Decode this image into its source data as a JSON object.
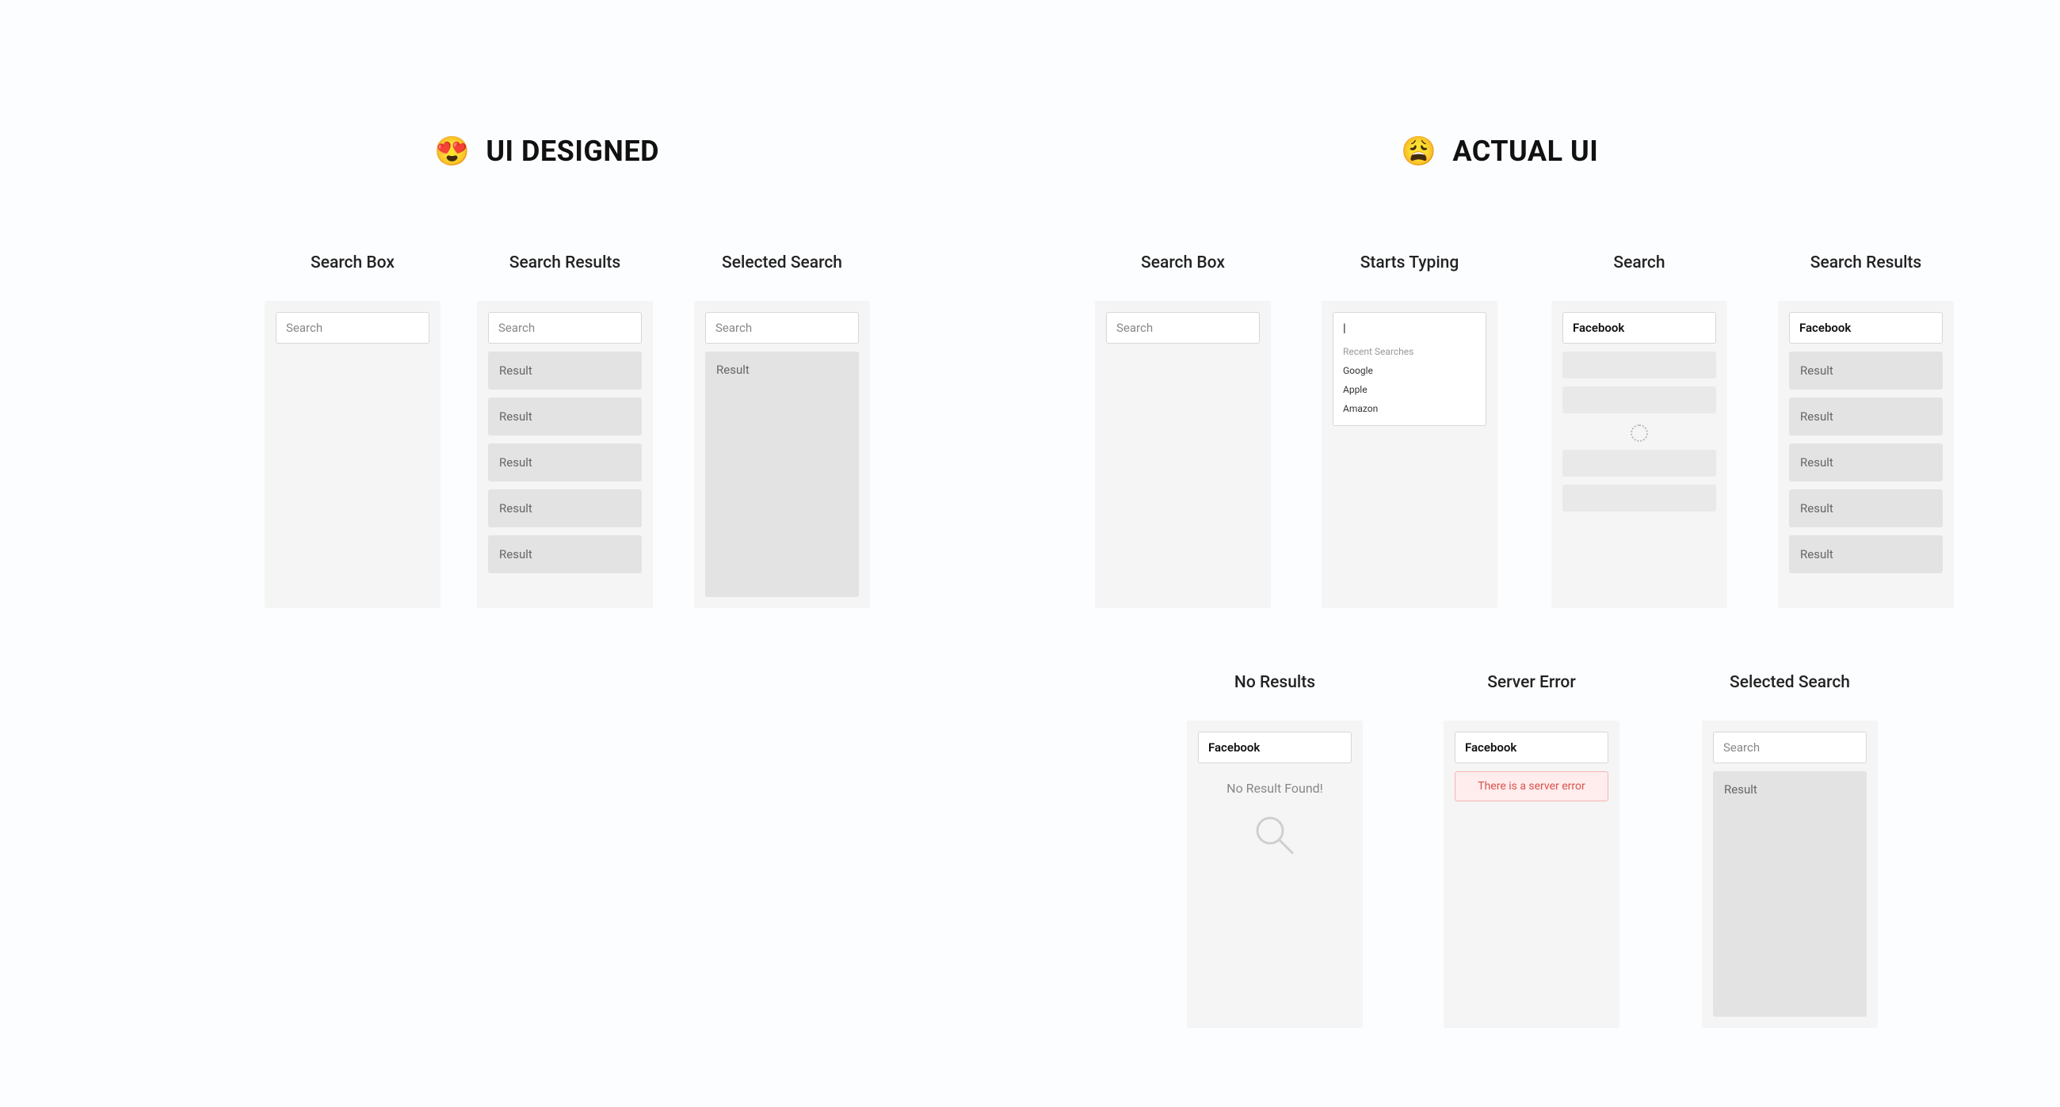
{
  "sections": {
    "designed": {
      "emoji": "😍",
      "title": "UI DESIGNED"
    },
    "actual": {
      "emoji": "😩",
      "title": "ACTUAL UI"
    }
  },
  "labels": {
    "search_box": "Search Box",
    "search_results": "Search Results",
    "selected_search": "Selected Search",
    "starts_typing": "Starts Typing",
    "search": "Search",
    "no_results": "No Results",
    "server_error": "Server Error"
  },
  "placeholders": {
    "search": "Search"
  },
  "values": {
    "facebook": "Facebook",
    "caret": "|"
  },
  "results": {
    "generic": [
      "Result",
      "Result",
      "Result",
      "Result",
      "Result"
    ],
    "single": "Result"
  },
  "dropdown": {
    "heading": "Recent Searches",
    "options": [
      "Google",
      "Apple",
      "Amazon"
    ]
  },
  "messages": {
    "no_result": "No Result Found!",
    "server_error": "There is a server error"
  }
}
